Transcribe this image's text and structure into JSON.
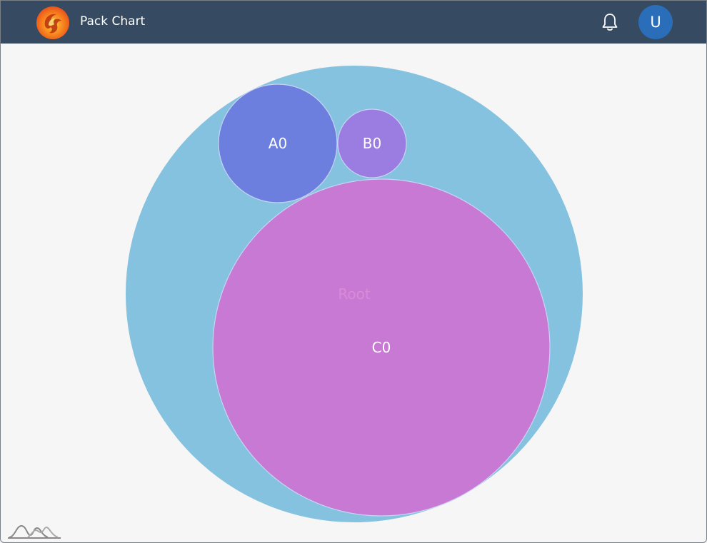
{
  "app": {
    "title": "Pack Chart",
    "user_initial": "U",
    "icons": [
      "phoenix-logo-icon",
      "bell-icon",
      "amcharts-logo-icon"
    ]
  },
  "colors": {
    "header": "#364a61",
    "avatar": "#2a6db8",
    "background": "#f6f6f6"
  },
  "chart_data": {
    "type": "pack",
    "root": {
      "name": "Root",
      "color": "#85c2e0",
      "label_color": "#d98bd8",
      "children": [
        {
          "name": "A0",
          "color": "#6c7fde",
          "label_color": "#ffffff"
        },
        {
          "name": "B0",
          "color": "#9b7ce0",
          "label_color": "#ffffff"
        },
        {
          "name": "C0",
          "color": "#c879d4",
          "label_color": "#ffffff"
        }
      ]
    }
  }
}
